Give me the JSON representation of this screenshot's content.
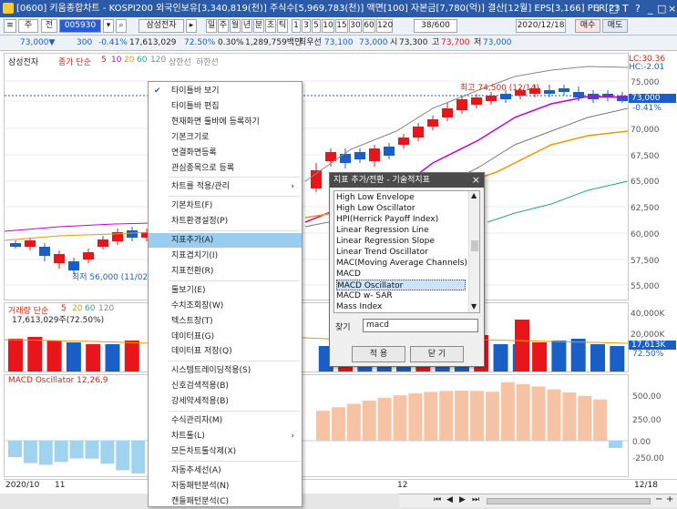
{
  "window": {
    "title": "[0600] 키움종합차트 - KOSPI200 외국인보유[3,340,819(천)] 주식수[5,969,783(천)] 액면[100] 자본금[7,780(억)] 결산[12월] EPS[3,166] PER[23",
    "controls": [
      "i",
      "□",
      "T",
      "?",
      "_",
      "□",
      "×"
    ]
  },
  "toolbar": {
    "code": "005930",
    "name": "삼성전자",
    "mode_btn": "주",
    "prev_btn": "전",
    "period_buttons": [
      "일",
      "주",
      "월",
      "년",
      "분",
      "초",
      "틱"
    ],
    "interval_buttons": [
      "1",
      "3",
      "5",
      "10",
      "15",
      "30",
      "60",
      "120"
    ],
    "count": "38/600",
    "date": "2020/12/18",
    "buy": "매수",
    "sell": "매도"
  },
  "quote": {
    "price": "73,000▼",
    "change": "300",
    "rate": "-0.41%",
    "volume": "17,613,029",
    "vol_ratio": "72.50%",
    "vol_pct": "0.30%",
    "amount": "1,289,759백만",
    "best": "최우선",
    "bid": "73,100",
    "ask": "73,000",
    "open_label": "시",
    "open": "73,300",
    "high_label": "고",
    "high": "73,700",
    "low_label": "저",
    "low": "73,000"
  },
  "legend": {
    "name": "삼성전자",
    "ma_label": "종가 단순",
    "ma": [
      "5",
      "10",
      "20",
      "60",
      "120"
    ],
    "upper": "상한선",
    "lower": "하한선",
    "lc": "LC:30.36",
    "hc": "HC:-2.01"
  },
  "price_axis": [
    "75,000",
    "73,000",
    "-0.41%",
    "70,000",
    "67,500",
    "65,000",
    "62,500",
    "60,000",
    "57,500",
    "55,000"
  ],
  "annotations": {
    "high": "최고 74,500 (12/14)",
    "low": "최저 56,000 (11/02)"
  },
  "volume": {
    "legend": "거래량 단순",
    "ma": [
      "5",
      "20",
      "60",
      "120"
    ],
    "value": "17,613,029주(72.50%)",
    "axis": [
      "40,000K",
      "20,000K",
      "17,613K",
      "72.50%"
    ]
  },
  "macd": {
    "legend": "MACD Oscillator 12,26,9",
    "axis": [
      "500.00",
      "250.00",
      "0.00",
      "-250.00"
    ]
  },
  "dates": [
    "2020/10",
    "11",
    "12",
    "12/18"
  ],
  "context_menu": [
    {
      "label": "타이틀바 보기",
      "checked": true
    },
    {
      "label": "타이틀바 편집"
    },
    {
      "label": "현재화면 툴바에 등록하기"
    },
    {
      "label": "기본크기로"
    },
    {
      "label": "연결화면등록"
    },
    {
      "label": "관심종목으로 등록"
    },
    {
      "label": "차트를 적용/관리",
      "arrow": true
    },
    {
      "label": "기본차트(F)"
    },
    {
      "label": "차트환경설정(P)"
    },
    {
      "label": "지표추가(A)",
      "highlight": true
    },
    {
      "label": "지표겹치기(I)"
    },
    {
      "label": "지표전환(R)"
    },
    {
      "label": "툴보기(E)"
    },
    {
      "label": "수치조회창(W)"
    },
    {
      "label": "텍스트창(T)"
    },
    {
      "label": "데이터표(G)"
    },
    {
      "label": "데이터표 저장(Q)"
    },
    {
      "label": "시스템트레이딩적용(S)"
    },
    {
      "label": "신호검색적용(B)"
    },
    {
      "label": "강세약세적용(B)"
    },
    {
      "label": "수식관리자(M)"
    },
    {
      "label": "차트툴(L)",
      "arrow": true
    },
    {
      "label": "모든차트툴삭제(X)"
    },
    {
      "label": "자동추세선(A)"
    },
    {
      "label": "자동패턴분석(N)"
    },
    {
      "label": "캔들패턴분석(C)"
    }
  ],
  "dialog": {
    "title": "지표 추가/전환 - 기술적지표",
    "items": [
      "High Low Envelope",
      "High Low Oscillator",
      "HPI(Herrick Payoff Index)",
      "Linear Regression Line",
      "Linear Regression Slope",
      "Linear Trend Oscillator",
      "MAC(Moving Average Channels)",
      "MACD",
      "MACD Oscillator",
      "MACD w- SAR",
      "Mass Index",
      "Median Price"
    ],
    "selected": "MACD Oscillator",
    "find_label": "찾기",
    "find_value": "macd",
    "apply": "적 용",
    "close": "닫 기"
  },
  "colors": {
    "up": "#e8161b",
    "down": "#1a5fc8",
    "highlight": "#99ccee",
    "macd_pos": "#f6c3a4",
    "macd_neg": "#9fd3ef"
  }
}
